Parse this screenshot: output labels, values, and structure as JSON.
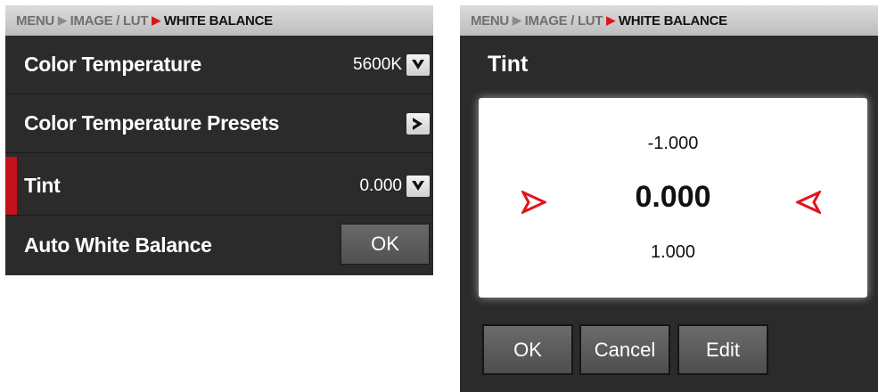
{
  "left": {
    "breadcrumb": {
      "menu": "MENU",
      "image": "IMAGE / LUT",
      "current": "WHITE BALANCE"
    },
    "rows": [
      {
        "label": "Color Temperature",
        "value": "5600K",
        "control": "dropdown"
      },
      {
        "label": "Color Temperature Presets",
        "control": "submenu"
      },
      {
        "label": "Tint",
        "value": "0.000",
        "control": "dropdown",
        "selected": true
      },
      {
        "label": "Auto White Balance",
        "button": "OK"
      }
    ]
  },
  "right": {
    "breadcrumb": {
      "menu": "MENU",
      "image": "IMAGE / LUT",
      "current": "WHITE BALANCE"
    },
    "title": "Tint",
    "picker": {
      "prev": "-1.000",
      "current": "0.000",
      "next": "1.000"
    },
    "buttons": {
      "ok": "OK",
      "cancel": "Cancel",
      "edit": "Edit"
    }
  },
  "colors": {
    "accent": "#c4121a",
    "panel": "#2b2b2b",
    "breadcrumb": "#cccccc"
  },
  "icons": {
    "dropdown": "chevron-down-icon",
    "submenu": "chevron-right-icon",
    "pointer": "red-arrow-icon"
  }
}
